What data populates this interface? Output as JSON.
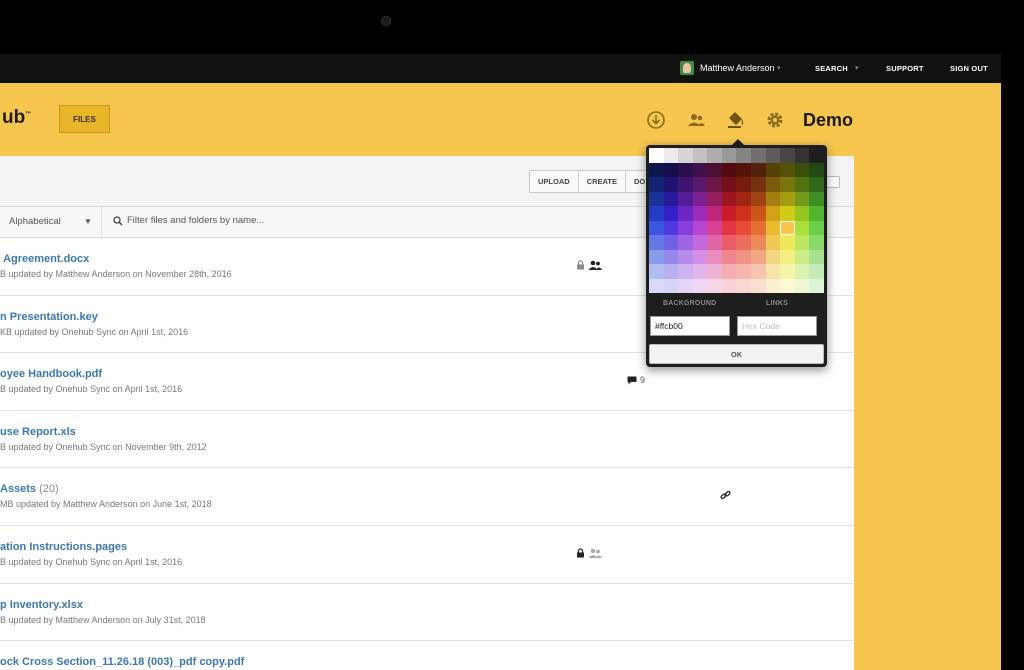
{
  "topbar": {
    "user_name": "Matthew Anderson",
    "search_label": "SEARCH",
    "support_label": "SUPPORT",
    "signout_label": "SIGN OUT"
  },
  "header": {
    "logo_text": "ub",
    "files_label": "FILES",
    "workspace_title": "Demo"
  },
  "toolbar": {
    "upload_label": "UPLOAD",
    "create_label": "CREATE",
    "more_label": "DO"
  },
  "filter": {
    "sort_value": "Alphabetical",
    "search_placeholder": "Filter files and folders by name..."
  },
  "files": [
    {
      "name": "Agreement.docx",
      "count": "",
      "meta": "B updated by Matthew Anderson on November 28th, 2016"
    },
    {
      "name": "n Presentation.key",
      "count": "",
      "meta": "KB updated by Onehub Sync on April 1st, 2016"
    },
    {
      "name": "oyee Handbook.pdf",
      "count": "",
      "meta": "B updated by Onehub Sync on April 1st, 2016"
    },
    {
      "name": "use Report.xls",
      "count": "",
      "meta": "B updated by Onehub Sync on November 9th, 2012"
    },
    {
      "name": "Assets",
      "count": "(20)",
      "meta": "MB updated by Matthew Anderson on June 1st, 2018"
    },
    {
      "name": "ation Instructions.pages",
      "count": "",
      "meta": "B updated by Onehub Sync on April 1st, 2016"
    },
    {
      "name": "p Inventory.xlsx",
      "count": "",
      "meta": "B updated by Matthew Anderson on July 31st, 2018"
    },
    {
      "name": "ock Cross Section_11.26.18 (003)_pdf copy.pdf",
      "count": "",
      "meta": ""
    }
  ],
  "row_badges": {
    "comment_count": "9"
  },
  "color_picker": {
    "background_label": "BACKGROUND",
    "links_label": "LINKS",
    "background_value": "#ffcb00",
    "links_placeholder": "Hex Code",
    "ok_label": "OK",
    "selected_color": "#f7c64f"
  },
  "colors": {
    "brand_yellow": "#f7c64f",
    "link_blue": "#3b77b3",
    "topbar_bg": "#111111"
  }
}
